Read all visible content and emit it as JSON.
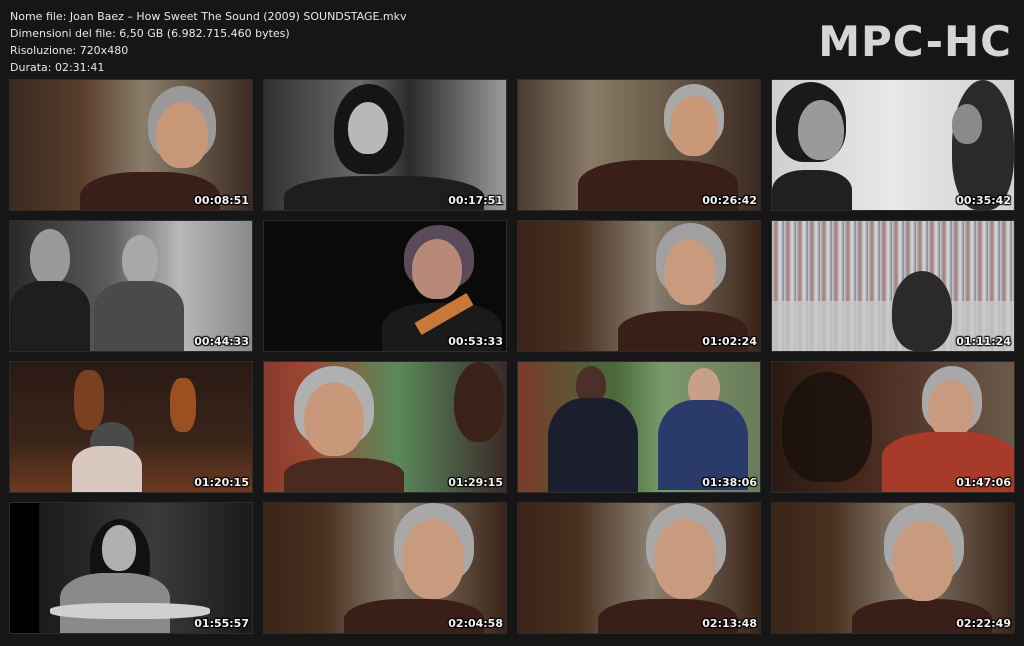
{
  "info": {
    "filename": "Nome file: Joan Baez – How Sweet The Sound (2009) SOUNDSTAGE.mkv",
    "filesize": "Dimensioni del file: 6,50 GB (6.982.715.460 bytes)",
    "resolution": "Risoluzione: 720x480",
    "duration": "Durata: 02:31:41"
  },
  "logo": "MPC-HC",
  "thumbnails": [
    {
      "time": "00:08:51"
    },
    {
      "time": "00:17:51"
    },
    {
      "time": "00:26:42"
    },
    {
      "time": "00:35:42"
    },
    {
      "time": "00:44:33"
    },
    {
      "time": "00:53:33"
    },
    {
      "time": "01:02:24"
    },
    {
      "time": "01:11:24"
    },
    {
      "time": "01:20:15"
    },
    {
      "time": "01:29:15"
    },
    {
      "time": "01:38:06"
    },
    {
      "time": "01:47:06"
    },
    {
      "time": "01:55:57"
    },
    {
      "time": "02:04:58"
    },
    {
      "time": "02:13:48"
    },
    {
      "time": "02:22:49"
    }
  ]
}
